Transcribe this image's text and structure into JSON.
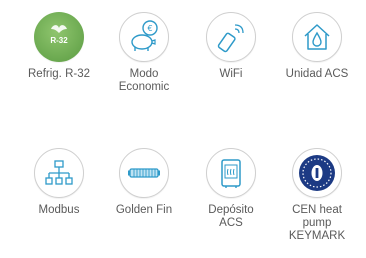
{
  "features": [
    {
      "icon": "refrigerant-leaf-icon",
      "lines": [
        "Refrig. R-32"
      ],
      "badge_text": "R-32"
    },
    {
      "icon": "piggy-bank-euro-icon",
      "lines": [
        "Modo",
        "Economic"
      ],
      "coin_symbol": "€"
    },
    {
      "icon": "wifi-remote-icon",
      "lines": [
        "WiFi"
      ]
    },
    {
      "icon": "house-water-drop-icon",
      "lines": [
        "Unidad ACS"
      ]
    },
    {
      "icon": "modbus-network-icon",
      "lines": [
        "Modbus"
      ]
    },
    {
      "icon": "golden-fin-icon",
      "lines": [
        "Golden Fin"
      ]
    },
    {
      "icon": "water-tank-icon",
      "lines": [
        "Depósito",
        "ACS"
      ]
    },
    {
      "icon": "keymark-certification-icon",
      "lines": [
        "CEN heat",
        "pump",
        "KEYMARK"
      ]
    }
  ],
  "colors": {
    "label": "#5a5a5a",
    "icon_stroke": "#2e9ac9",
    "ring": "#cfcfcf",
    "green": "#6aa84f",
    "navy": "#1c3a84"
  }
}
